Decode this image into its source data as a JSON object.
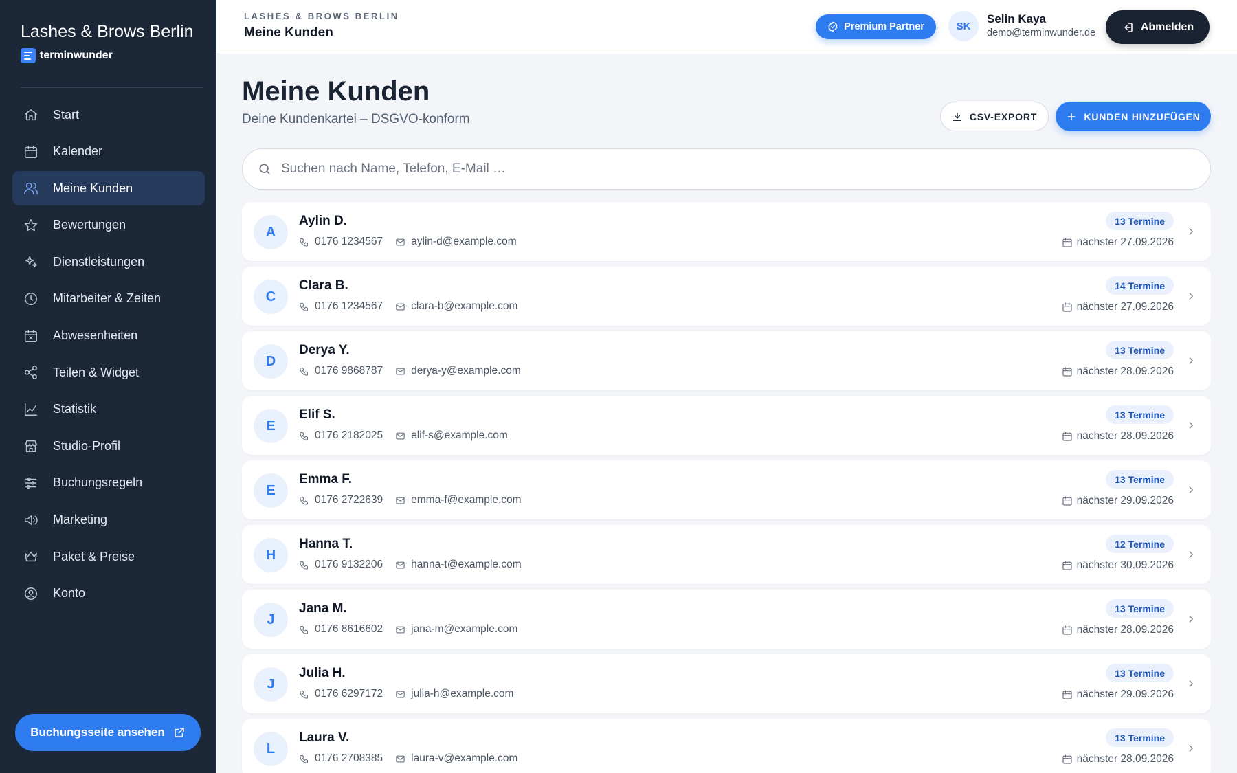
{
  "sidebar": {
    "brand_title": "Lashes & Brows Berlin",
    "brand_sub": "terminwunder",
    "items": [
      {
        "label": "Start",
        "icon": "home-icon",
        "active": false
      },
      {
        "label": "Kalender",
        "icon": "calendar-icon",
        "active": false
      },
      {
        "label": "Meine Kunden",
        "icon": "users-icon",
        "active": true
      },
      {
        "label": "Bewertungen",
        "icon": "star-icon",
        "active": false
      },
      {
        "label": "Dienstleistungen",
        "icon": "sparkles-icon",
        "active": false
      },
      {
        "label": "Mitarbeiter & Zeiten",
        "icon": "clock-icon",
        "active": false
      },
      {
        "label": "Abwesenheiten",
        "icon": "calendar-x-icon",
        "active": false
      },
      {
        "label": "Teilen & Widget",
        "icon": "share-icon",
        "active": false
      },
      {
        "label": "Statistik",
        "icon": "chart-icon",
        "active": false
      },
      {
        "label": "Studio-Profil",
        "icon": "store-icon",
        "active": false
      },
      {
        "label": "Buchungsregeln",
        "icon": "sliders-icon",
        "active": false
      },
      {
        "label": "Marketing",
        "icon": "megaphone-icon",
        "active": false
      },
      {
        "label": "Paket & Preise",
        "icon": "crown-icon",
        "active": false
      },
      {
        "label": "Konto",
        "icon": "user-circle-icon",
        "active": false
      }
    ],
    "booking_button": "Buchungsseite ansehen"
  },
  "header": {
    "kicker": "LASHES & BROWS BERLIN",
    "title": "Meine Kunden",
    "premium_label": "Premium Partner",
    "avatar_initials": "SK",
    "user_name": "Selin Kaya",
    "user_email": "demo@terminwunder.de",
    "logout_label": "Abmelden"
  },
  "main": {
    "title": "Meine Kunden",
    "subtitle": "Deine Kundenkartei – DSGVO-konform",
    "csv_label": "CSV-EXPORT",
    "add_label": "KUNDEN HINZUFÜGEN",
    "search_placeholder": "Suchen nach Name, Telefon, E-Mail …"
  },
  "customers": [
    {
      "initial": "A",
      "name": "Aylin D.",
      "phone": "0176 1234567",
      "email": "aylin-d@example.com",
      "appointments": "13 Termine",
      "next": "nächster 27.09.2026"
    },
    {
      "initial": "C",
      "name": "Clara B.",
      "phone": "0176 1234567",
      "email": "clara-b@example.com",
      "appointments": "14 Termine",
      "next": "nächster 27.09.2026"
    },
    {
      "initial": "D",
      "name": "Derya Y.",
      "phone": "0176 9868787",
      "email": "derya-y@example.com",
      "appointments": "13 Termine",
      "next": "nächster 28.09.2026"
    },
    {
      "initial": "E",
      "name": "Elif S.",
      "phone": "0176 2182025",
      "email": "elif-s@example.com",
      "appointments": "13 Termine",
      "next": "nächster 28.09.2026"
    },
    {
      "initial": "E",
      "name": "Emma F.",
      "phone": "0176 2722639",
      "email": "emma-f@example.com",
      "appointments": "13 Termine",
      "next": "nächster 29.09.2026"
    },
    {
      "initial": "H",
      "name": "Hanna T.",
      "phone": "0176 9132206",
      "email": "hanna-t@example.com",
      "appointments": "12 Termine",
      "next": "nächster 30.09.2026"
    },
    {
      "initial": "J",
      "name": "Jana M.",
      "phone": "0176 8616602",
      "email": "jana-m@example.com",
      "appointments": "13 Termine",
      "next": "nächster 28.09.2026"
    },
    {
      "initial": "J",
      "name": "Julia H.",
      "phone": "0176 6297172",
      "email": "julia-h@example.com",
      "appointments": "13 Termine",
      "next": "nächster 29.09.2026"
    },
    {
      "initial": "L",
      "name": "Laura V.",
      "phone": "0176 2708385",
      "email": "laura-v@example.com",
      "appointments": "13 Termine",
      "next": "nächster 28.09.2026"
    }
  ],
  "colors": {
    "sidebar_bg": "#1c2738",
    "accent": "#2f7cf0",
    "active_nav_bg": "#263a5c",
    "page_bg": "#f3f5f9"
  }
}
